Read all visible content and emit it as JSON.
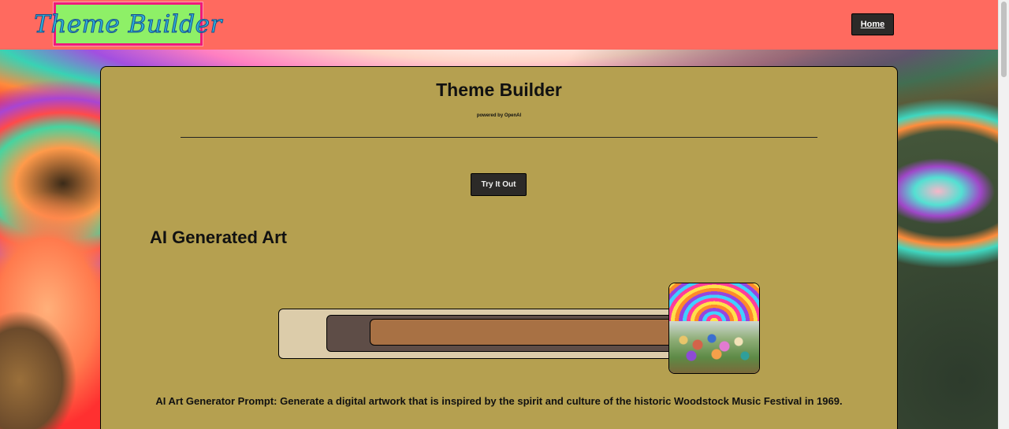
{
  "nav": {
    "logo_text": "Theme Builder",
    "home_label": "Home"
  },
  "card": {
    "title": "Theme Builder",
    "subtitle": "powered by OpenAI",
    "try_label": "Try It Out",
    "section_title": "AI Generated Art",
    "prompt": "AI Art Generator Prompt: Generate a digital artwork that is inspired by the spirit and culture of the historic Woodstock Music Festival in 1969."
  },
  "palette": {
    "colors": [
      "#dcccaa",
      "#5e4d47",
      "#a87144"
    ]
  },
  "theme": {
    "nav_bg": "#ff6a5f",
    "card_bg": "#b5a050",
    "logo_bg": "#8ef067",
    "logo_border": "#f01a7b",
    "button_bg": "#2c2a28"
  },
  "icons": {
    "art_thumbnail": "woodstock-art-image"
  }
}
